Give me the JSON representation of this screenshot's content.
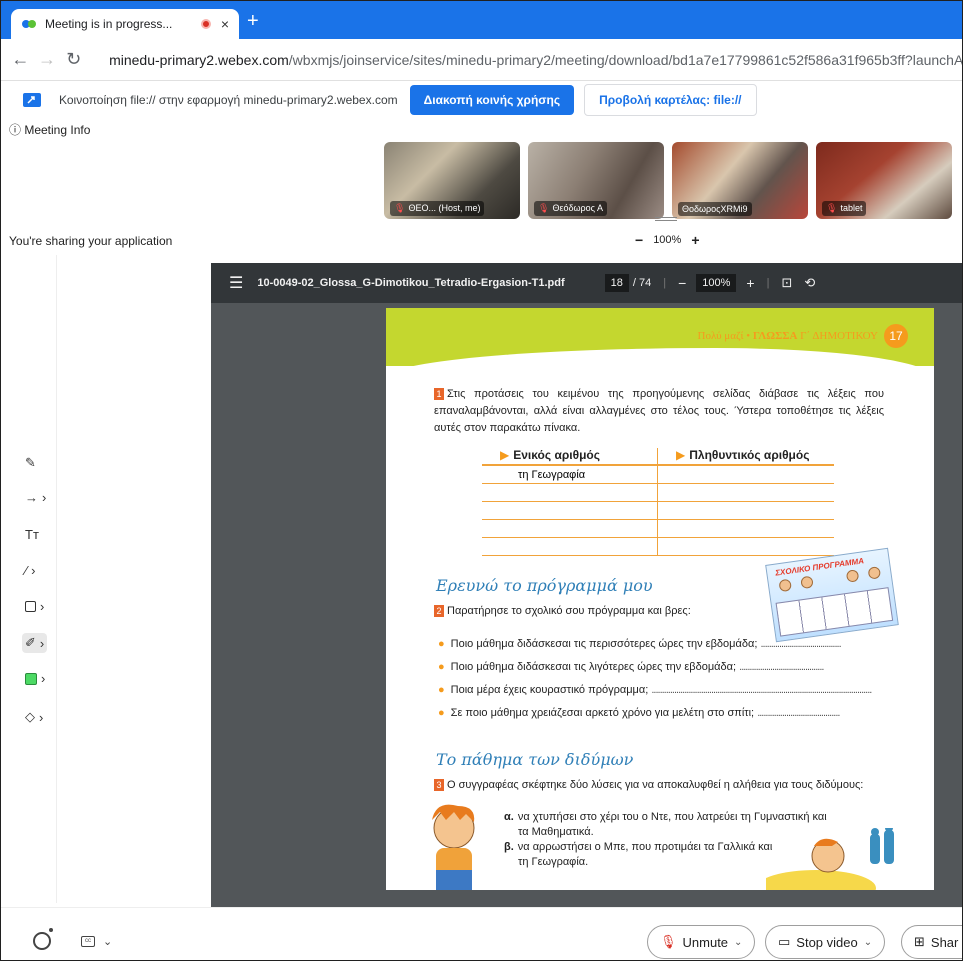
{
  "browser": {
    "tab_title": "Meeting is in progress...",
    "tab_close": "×",
    "new_tab": "+",
    "url_host": "minedu-primary2.webex.com",
    "url_path": "/wbxmjs/joinservice/sites/minedu-primary2/meeting/download/bd1a7e17799861c52f586a31f965b3ff?launchApp=tr"
  },
  "sharebar": {
    "message": "Κοινοποίηση file:// στην εφαρμογή minedu-primary2.webex.com",
    "stop_label": "Διακοπή κοινής χρήσης",
    "view_label": "Προβολή καρτέλας: file://"
  },
  "meeting": {
    "info_label": "ⓘ Meeting Info",
    "sharing_text": "You're sharing your application",
    "zoom_minus": "−",
    "zoom_value": "100%",
    "zoom_plus": "+",
    "participants": [
      {
        "name": "ΘΕΟ... (Host, me)"
      },
      {
        "name": "Θεόδωρος Α"
      },
      {
        "name": "ΘοδωροςXRMi9"
      },
      {
        "name": "tablet"
      }
    ]
  },
  "tools": [
    {
      "icon": "pen-icon",
      "glyph": "✎",
      "chev": ""
    },
    {
      "icon": "arrow-icon",
      "glyph": "→",
      "chev": "›"
    },
    {
      "icon": "text-icon",
      "glyph": "Tт",
      "chev": ""
    },
    {
      "icon": "line-icon",
      "glyph": "⁄",
      "chev": "›"
    },
    {
      "icon": "rectangle-icon",
      "glyph": "",
      "chev": "›"
    },
    {
      "icon": "highlighter-icon",
      "glyph": "✐",
      "chev": "›"
    },
    {
      "icon": "color-icon",
      "glyph": "",
      "chev": "›"
    },
    {
      "icon": "eraser-icon",
      "glyph": "◇",
      "chev": "›"
    }
  ],
  "pdf": {
    "filename": "10-0049-02_Glossa_G-Dimotikou_Tetradio-Ergasion-T1.pdf",
    "page": "18",
    "total": "/ 74",
    "zoom": "100%",
    "header_text": "Πολύ μαζί • ",
    "header_bold": "ΓΛΩΣΣΑ",
    "header_rest": " Γ΄ ΔΗΜΟΤΙΚΟΥ",
    "page_number": "17",
    "ex1_num": "1",
    "ex1_text": "Στις προτάσεις του κειμένου της προηγούμενης σελίδας διάβασε τις λέξεις που επαναλαμβάνονται, αλλά είναι αλλαγμένες στο τέλος τους. Ύστερα τοποθέτησε τις λέξεις αυτές στον παρακάτω πίνακα.",
    "col1": "Ενικός αριθμός",
    "col2": "Πληθυντικός αριθμός",
    "row1": "τη Γεωγραφία",
    "section2_title": "Ερευνώ το πρόγραμμά μου",
    "ex2_num": "2",
    "ex2_text": "Παρατήρησε το σχολικό σου πρόγραμμα και βρες:",
    "program_title": "ΣΧΟΛΙΚΟ ΠΡΟΓΡΑΜΜΑ",
    "questions": [
      "Ποιο μάθημα διδάσκεσαι τις περισσότερες ώρες την εβδομάδα;",
      "Ποιο μάθημα διδάσκεσαι τις λιγότερες ώρες την εβδομάδα;",
      "Ποια μέρα έχεις κουραστικό πρόγραμμα;",
      "Σε ποιο μάθημα χρειάζεσαι αρκετό χρόνο για μελέτη στο σπίτι;"
    ],
    "section3_title": "Το πάθημα των διδύμων",
    "ex3_num": "3",
    "ex3_text": "Ο συγγραφέας σκέφτηκε δύο λύσεις για να αποκαλυφθεί η αλήθεια για τους διδύμους:",
    "opt_a_letter": "α.",
    "opt_a1": "να χτυπήσει στο χέρι του ο Ντε, που λατρεύει τη Γυμναστική και",
    "opt_a2": "τα Μαθηματικά.",
    "opt_b_letter": "β.",
    "opt_b1": "να αρρωστήσει ο Μπε, που προτιμάει τα Γαλλικά και",
    "opt_b2": "τη Γεωγραφία."
  },
  "bottom": {
    "unmute_label": "Unmute",
    "stop_video_label": "Stop video",
    "share_label": "Shar"
  },
  "colors": {
    "browser_blue": "#1a73e8",
    "pdf_dark": "#323639",
    "accent_orange": "#f59b1d",
    "header_green": "#c4d72f"
  }
}
